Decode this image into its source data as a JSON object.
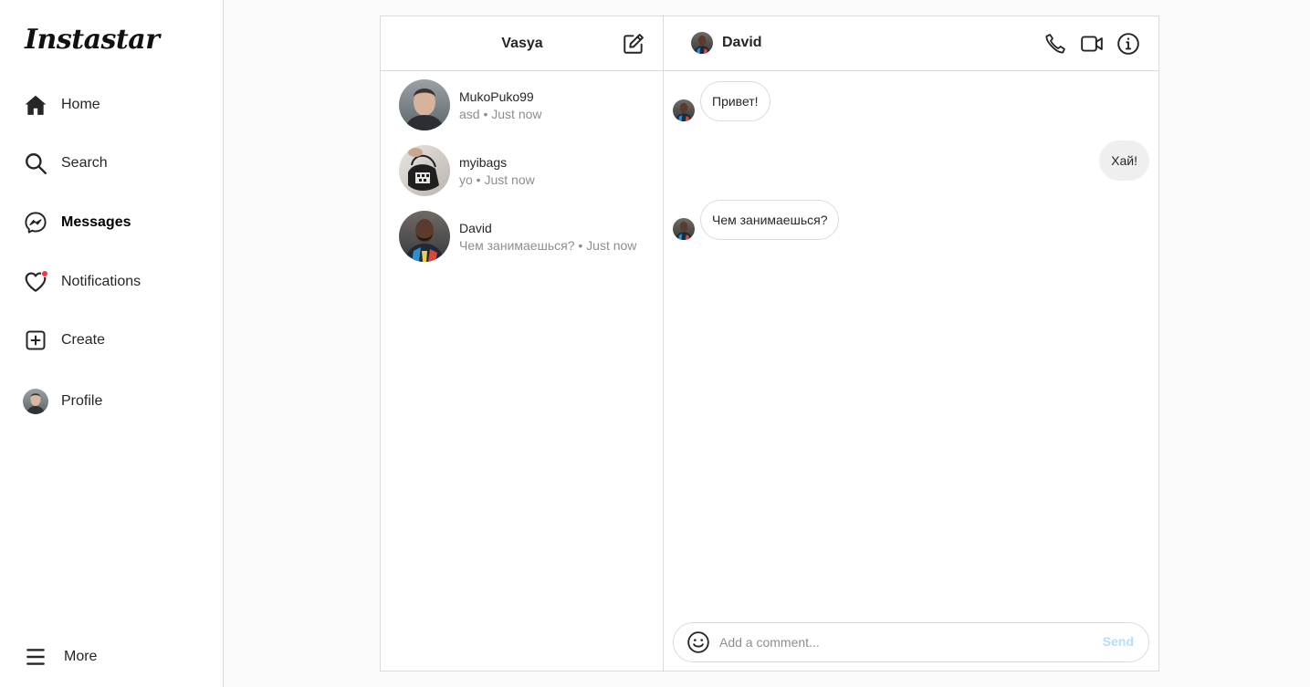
{
  "app": {
    "logo": "Instastar"
  },
  "sidebar": {
    "items": [
      {
        "label": "Home",
        "icon": "home-icon"
      },
      {
        "label": "Search",
        "icon": "search-icon"
      },
      {
        "label": "Messages",
        "icon": "messenger-icon",
        "active": true
      },
      {
        "label": "Notifications",
        "icon": "heart-icon",
        "badge": "red-dot"
      },
      {
        "label": "Create",
        "icon": "plus-square-icon"
      },
      {
        "label": "Profile",
        "icon": "avatar"
      }
    ],
    "more": {
      "label": "More",
      "icon": "hamburger-icon"
    }
  },
  "conversations": {
    "owner": "Vasya",
    "compose_icon": "edit-icon",
    "threads": [
      {
        "name": "MukoPuko99",
        "last_message": "asd",
        "time": "Just now"
      },
      {
        "name": "myibags",
        "last_message": "yo",
        "time": "Just now"
      },
      {
        "name": "David",
        "last_message": "Чем занимаешься?",
        "time": "Just now"
      }
    ]
  },
  "chat": {
    "peer_name": "David",
    "header_icons": [
      "phone-icon",
      "video-icon",
      "info-icon"
    ],
    "messages": [
      {
        "text": "Привет!",
        "from": "peer"
      },
      {
        "text": "Хай!",
        "from": "me"
      },
      {
        "text": "Чем занимаешься?",
        "from": "peer"
      }
    ],
    "composer": {
      "placeholder": "Add a comment...",
      "value": "",
      "send_label": "Send",
      "emoji_icon": "smiley-icon"
    }
  },
  "colors": {
    "accent": "#0095f6",
    "send_disabled": "#b2dffc",
    "notification_dot": "#ff3040",
    "border": "#dbdbdb",
    "my_bubble": "#efefef"
  }
}
